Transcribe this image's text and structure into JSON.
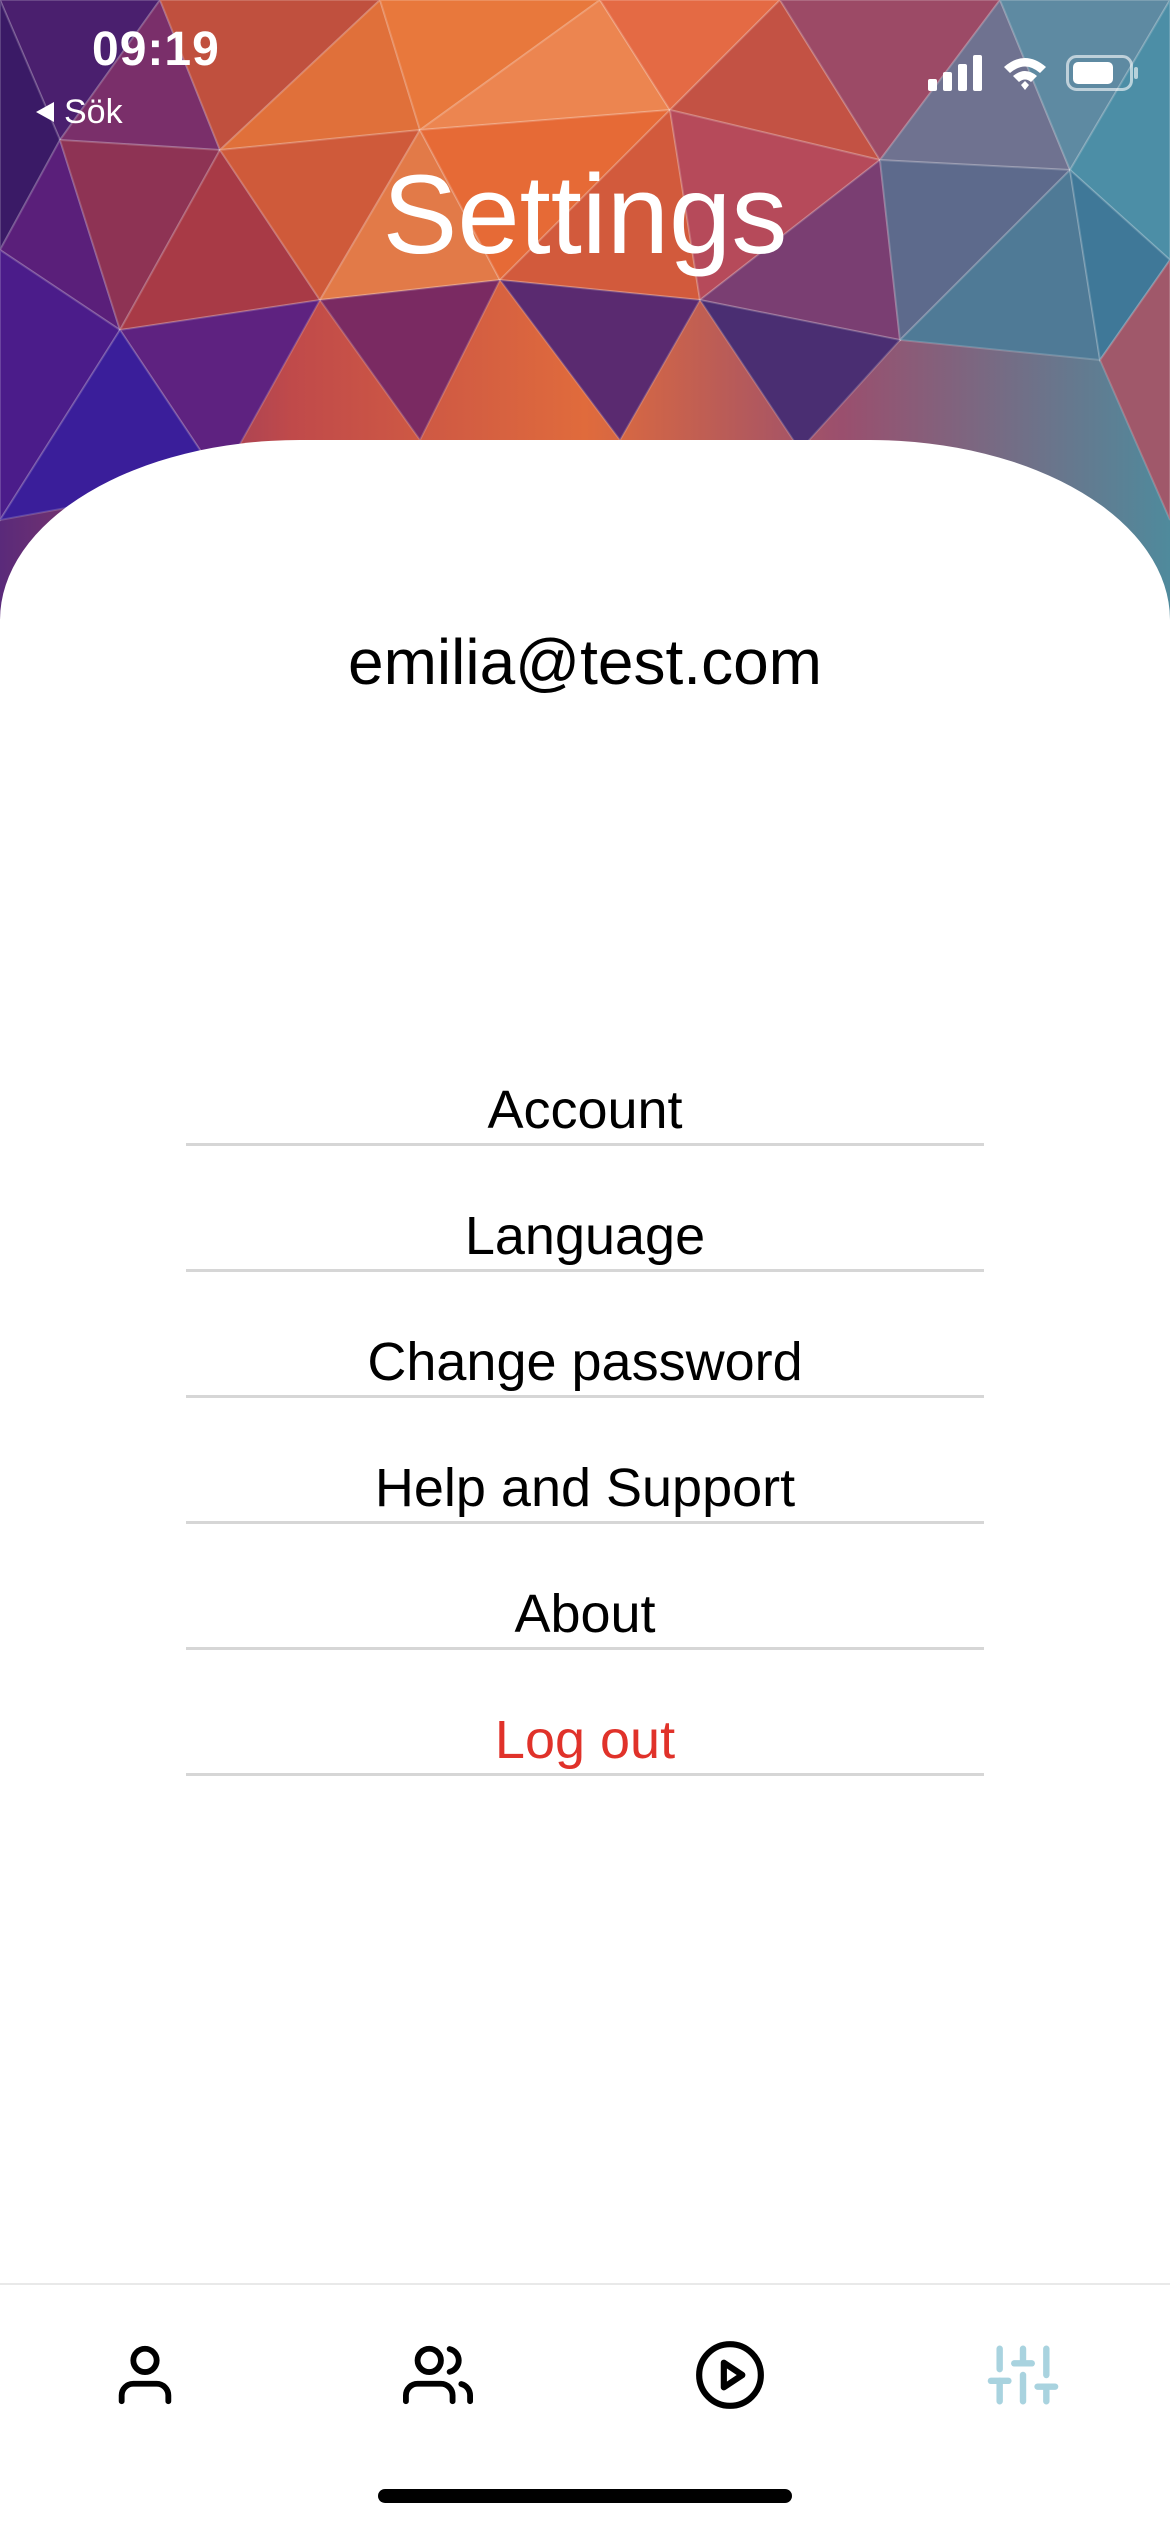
{
  "status_bar": {
    "time": "09:19",
    "back_label": "Sök"
  },
  "header": {
    "title": "Settings"
  },
  "account": {
    "email": "emilia@test.com"
  },
  "menu": {
    "items": [
      {
        "label": "Account"
      },
      {
        "label": "Language"
      },
      {
        "label": "Change password"
      },
      {
        "label": "Help and Support"
      },
      {
        "label": "About"
      },
      {
        "label": "Log out"
      }
    ]
  },
  "tab_bar": {
    "tabs": [
      {
        "icon": "person-icon",
        "active": false
      },
      {
        "icon": "people-icon",
        "active": false
      },
      {
        "icon": "play-circle-icon",
        "active": false
      },
      {
        "icon": "sliders-icon",
        "active": true
      }
    ]
  },
  "colors": {
    "logout": "#e0322a",
    "active_tab": "#a9d3df",
    "divider": "#d6d6d6"
  }
}
